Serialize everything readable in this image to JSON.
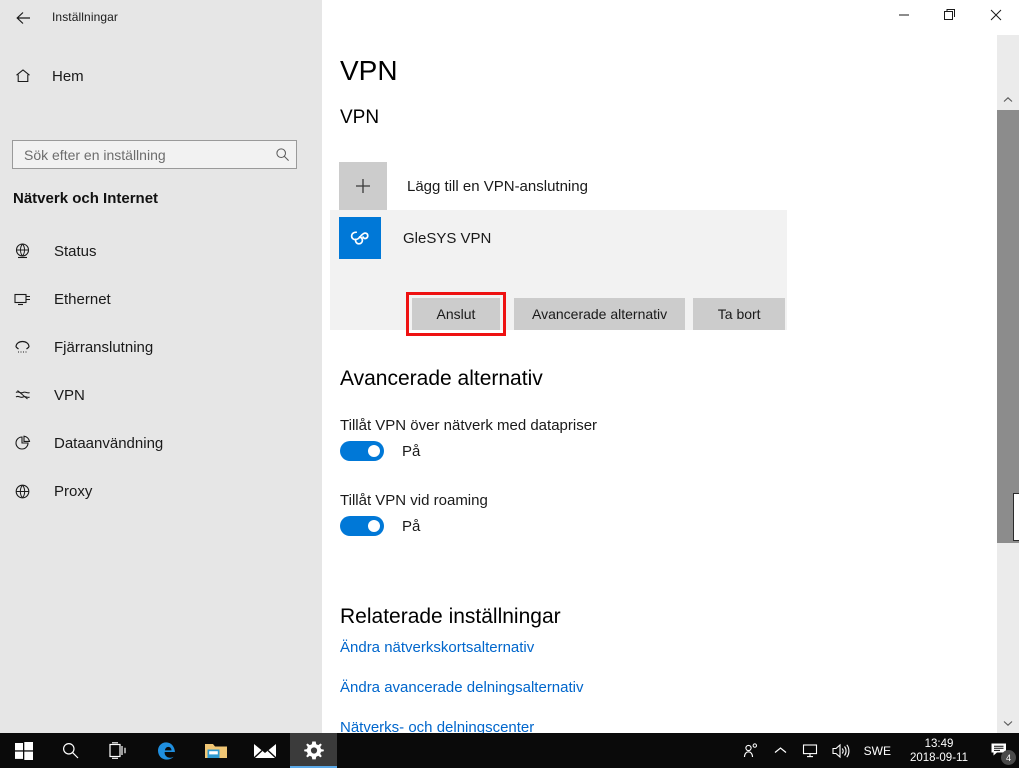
{
  "titlebar": {
    "back_icon": "back-arrow-icon",
    "title": "Inställningar",
    "minimize_icon": "minimize-icon",
    "maximize_icon": "restore-icon",
    "close_icon": "close-icon"
  },
  "sidebar": {
    "home": {
      "icon": "home-icon",
      "label": "Hem"
    },
    "search": {
      "placeholder": "Sök efter en inställning",
      "value": "",
      "icon": "search-icon"
    },
    "heading": "Nätverk och Internet",
    "items": [
      {
        "label": "Status",
        "icon": "globe-status-icon"
      },
      {
        "label": "Ethernet",
        "icon": "ethernet-icon"
      },
      {
        "label": "Fjärranslutning",
        "icon": "dialup-icon"
      },
      {
        "label": "VPN",
        "icon": "vpn-icon"
      },
      {
        "label": "Dataanvändning",
        "icon": "pie-chart-icon"
      },
      {
        "label": "Proxy",
        "icon": "globe-icon"
      }
    ]
  },
  "main": {
    "page_title": "VPN",
    "vpn_section_heading": "VPN",
    "add_vpn": {
      "icon": "plus-icon",
      "label": "Lägg till en VPN-anslutning"
    },
    "vpn_entry": {
      "name": "GleSYS VPN",
      "logo_icon": "glesys-logo-icon",
      "logo_color": "#0078D7",
      "buttons": {
        "connect": "Anslut",
        "advanced": "Avancerade alternativ",
        "remove": "Ta bort"
      },
      "highlight_color": "#EE1111"
    },
    "advanced": {
      "heading": "Avancerade alternativ",
      "options": [
        {
          "label": "Tillåt VPN över nätverk med datapriser",
          "state": "På",
          "on": true
        },
        {
          "label": "Tillåt VPN vid roaming",
          "state": "På",
          "on": true
        }
      ],
      "toggle_on_color": "#0078D7"
    },
    "related": {
      "heading": "Relaterade inställningar",
      "links": [
        "Ändra nätverkskortsalternativ",
        "Ändra avancerade delningsalternativ",
        "Nätverks- och delningscenter"
      ],
      "link_color": "#0066CC"
    }
  },
  "scrollbar": {
    "up_icon": "chevron-up-icon",
    "down_icon": "chevron-down-icon"
  },
  "taskbar": {
    "items": [
      {
        "name": "start-button",
        "icon": "windows-logo-icon"
      },
      {
        "name": "search-button",
        "icon": "search-icon"
      },
      {
        "name": "task-view-button",
        "icon": "task-view-icon"
      },
      {
        "name": "edge-button",
        "icon": "edge-icon"
      },
      {
        "name": "file-explorer-button",
        "icon": "folder-icon"
      },
      {
        "name": "mail-button",
        "icon": "mail-icon"
      },
      {
        "name": "settings-button",
        "icon": "gear-icon"
      }
    ],
    "tray": {
      "people_icon": "people-icon",
      "chevron_icon": "chevron-up-icon",
      "network_icon": "network-icon",
      "volume_icon": "volume-icon",
      "language": "SWE",
      "time": "13:49",
      "date": "2018-09-11",
      "notification_icon": "notification-icon",
      "notification_count": "4"
    }
  }
}
